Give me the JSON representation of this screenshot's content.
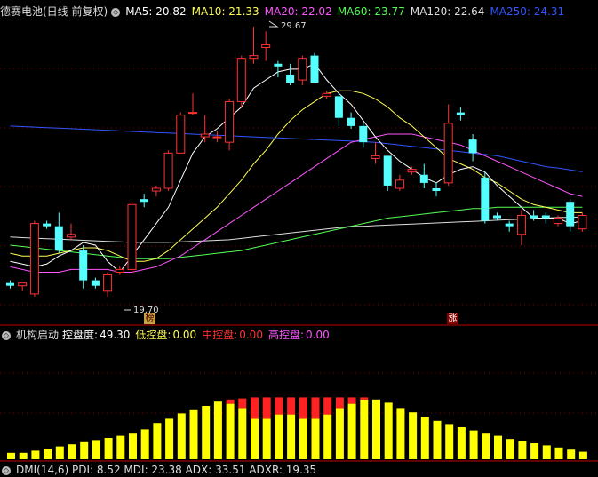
{
  "header": {
    "title": "德赛电池(日线 前复权)",
    "ma": [
      {
        "label": "MA5: 20.82",
        "color": "#ffffff"
      },
      {
        "label": "MA10: 21.33",
        "color": "#ffff55"
      },
      {
        "label": "MA20: 22.02",
        "color": "#ff55ff"
      },
      {
        "label": "MA60: 23.77",
        "color": "#55ff55"
      },
      {
        "label": "MA120: 22.64",
        "color": "#dddddd"
      },
      {
        "label": "MA250: 24.31",
        "color": "#3355ff"
      }
    ]
  },
  "annotations": {
    "high": "29.67",
    "low": "19.70",
    "badge_left": "榜",
    "badge_right": "涨"
  },
  "indicator": {
    "title": "机构启动",
    "control_label": "控盘度:",
    "control_value": "49.30",
    "low_label": "低控盘:",
    "low_value": "0.00",
    "mid_label": "中控盘:",
    "mid_value": "0.00",
    "high_label": "高控盘:",
    "high_value": "0.00"
  },
  "dmi": {
    "text": "DMI(14,6)  PDI: 8.52  MDI: 23.38  ADX: 33.51  ADXR: 19.35"
  },
  "colors": {
    "up": "#ff3333",
    "down": "#55ffff",
    "yellow": "#ffff00",
    "red": "#ff2222"
  },
  "chart_data": {
    "type": "candlestick",
    "candles": [
      [
        20.2,
        20.3,
        20.0,
        20.1
      ],
      [
        20.1,
        20.2,
        19.9,
        20.2
      ],
      [
        19.8,
        22.5,
        19.7,
        22.4
      ],
      [
        22.4,
        22.5,
        22.2,
        22.3
      ],
      [
        22.3,
        22.8,
        21.3,
        21.4
      ],
      [
        21.9,
        22.4,
        21.8,
        22.0
      ],
      [
        21.4,
        21.6,
        20.0,
        20.3
      ],
      [
        20.3,
        20.4,
        20.0,
        20.1
      ],
      [
        19.9,
        20.6,
        19.7,
        20.5
      ],
      [
        20.6,
        20.8,
        20.5,
        20.7
      ],
      [
        20.7,
        23.2,
        20.6,
        23.1
      ],
      [
        23.3,
        23.5,
        23.0,
        23.2
      ],
      [
        23.6,
        23.8,
        23.4,
        23.7
      ],
      [
        23.7,
        25.1,
        23.6,
        25.0
      ],
      [
        25.0,
        26.5,
        25.0,
        26.4
      ],
      [
        26.5,
        27.2,
        26.4,
        26.5
      ],
      [
        25.6,
        26.4,
        25.4,
        25.7
      ],
      [
        25.6,
        25.8,
        25.4,
        25.6
      ],
      [
        25.4,
        27.0,
        25.1,
        26.9
      ],
      [
        26.9,
        28.6,
        26.7,
        28.5
      ],
      [
        28.5,
        29.67,
        28.3,
        28.6
      ],
      [
        28.9,
        29.5,
        28.4,
        29.0
      ],
      [
        28.3,
        28.4,
        27.8,
        28.2
      ],
      [
        27.9,
        28.3,
        27.5,
        27.6
      ],
      [
        27.7,
        28.6,
        27.5,
        28.5
      ],
      [
        28.6,
        28.7,
        27.6,
        27.6
      ],
      [
        27.1,
        27.3,
        27.0,
        27.2
      ],
      [
        27.1,
        27.2,
        26.0,
        26.3
      ],
      [
        26.3,
        26.5,
        25.9,
        26.0
      ],
      [
        26.0,
        26.1,
        25.2,
        25.4
      ],
      [
        24.8,
        25.4,
        24.6,
        24.9
      ],
      [
        24.9,
        24.9,
        23.6,
        23.8
      ],
      [
        23.7,
        24.2,
        23.6,
        24.0
      ],
      [
        24.3,
        24.5,
        24.2,
        24.4
      ],
      [
        24.2,
        24.6,
        23.7,
        23.9
      ],
      [
        23.7,
        23.9,
        23.4,
        23.6
      ],
      [
        23.9,
        26.8,
        23.8,
        26.1
      ],
      [
        26.5,
        26.7,
        26.2,
        26.4
      ],
      [
        25.5,
        25.7,
        24.7,
        25.0
      ],
      [
        24.1,
        24.3,
        22.4,
        22.5
      ],
      [
        22.7,
        22.8,
        22.5,
        22.6
      ],
      [
        22.4,
        22.5,
        22.1,
        22.3
      ],
      [
        22.0,
        22.9,
        21.6,
        22.7
      ],
      [
        22.7,
        22.9,
        22.5,
        22.6
      ],
      [
        22.7,
        22.8,
        22.4,
        22.6
      ],
      [
        22.4,
        22.7,
        22.3,
        22.6
      ],
      [
        23.2,
        23.3,
        22.1,
        22.3
      ],
      [
        22.2,
        22.8,
        22.1,
        22.7
      ]
    ],
    "ma5": [
      21.0,
      20.9,
      20.8,
      20.9,
      21.2,
      21.4,
      21.7,
      21.6,
      21.0,
      20.6,
      21.2,
      21.8,
      22.4,
      23.0,
      24.0,
      25.0,
      25.6,
      25.9,
      26.3,
      26.7,
      27.4,
      27.7,
      28.0,
      28.1,
      28.1,
      28.3,
      27.7,
      27.2,
      26.8,
      26.2,
      25.6,
      25.1,
      24.7,
      24.4,
      24.1,
      23.9,
      24.2,
      24.4,
      24.5,
      24.3,
      23.8,
      23.4,
      23.0,
      22.6,
      22.6,
      22.6,
      22.4,
      22.5
    ],
    "ma10": [
      21.3,
      21.2,
      21.2,
      21.2,
      21.3,
      21.4,
      21.5,
      21.5,
      21.4,
      21.2,
      21.0,
      21.0,
      21.1,
      21.4,
      21.8,
      22.2,
      22.6,
      23.0,
      23.5,
      24.0,
      24.6,
      25.1,
      25.7,
      26.2,
      26.6,
      26.9,
      27.2,
      27.3,
      27.3,
      27.2,
      27.0,
      26.7,
      26.3,
      26.0,
      25.6,
      25.2,
      24.8,
      24.6,
      24.4,
      24.1,
      23.9,
      23.6,
      23.3,
      23.1,
      23.0,
      22.9,
      22.8,
      22.8
    ],
    "ma20": [
      20.8,
      20.7,
      20.6,
      20.6,
      20.6,
      20.7,
      20.7,
      20.7,
      20.7,
      20.6,
      20.6,
      20.7,
      20.8,
      21.0,
      21.2,
      21.5,
      21.8,
      22.1,
      22.4,
      22.7,
      23.0,
      23.3,
      23.6,
      23.9,
      24.2,
      24.5,
      24.8,
      25.1,
      25.4,
      25.5,
      25.6,
      25.7,
      25.7,
      25.7,
      25.6,
      25.5,
      25.4,
      25.3,
      25.1,
      24.9,
      24.7,
      24.5,
      24.3,
      24.1,
      23.9,
      23.7,
      23.5,
      23.4
    ],
    "ma60": [
      21.6,
      21.55,
      21.5,
      21.45,
      21.4,
      21.35,
      21.3,
      21.25,
      21.2,
      21.15,
      21.1,
      21.1,
      21.1,
      21.1,
      21.15,
      21.2,
      21.25,
      21.3,
      21.35,
      21.4,
      21.5,
      21.6,
      21.7,
      21.8,
      21.9,
      22.0,
      22.1,
      22.2,
      22.3,
      22.4,
      22.5,
      22.6,
      22.65,
      22.7,
      22.75,
      22.8,
      22.85,
      22.9,
      22.95,
      22.95,
      23.0,
      23.0,
      23.0,
      23.0,
      23.0,
      23.0,
      23.0,
      23.0
    ],
    "ma120": [
      21.9,
      21.88,
      21.86,
      21.84,
      21.82,
      21.8,
      21.78,
      21.76,
      21.74,
      21.72,
      21.7,
      21.7,
      21.7,
      21.7,
      21.72,
      21.74,
      21.76,
      21.78,
      21.8,
      21.85,
      21.9,
      21.95,
      22.0,
      22.05,
      22.1,
      22.15,
      22.2,
      22.25,
      22.3,
      22.3,
      22.32,
      22.34,
      22.36,
      22.38,
      22.4,
      22.42,
      22.44,
      22.46,
      22.48,
      22.5,
      22.52,
      22.54,
      22.56,
      22.58,
      22.6,
      22.62,
      22.63,
      22.64
    ],
    "ma250": [
      26.0,
      25.98,
      25.96,
      25.94,
      25.92,
      25.9,
      25.88,
      25.86,
      25.84,
      25.82,
      25.8,
      25.78,
      25.76,
      25.74,
      25.72,
      25.7,
      25.68,
      25.66,
      25.64,
      25.62,
      25.6,
      25.58,
      25.56,
      25.54,
      25.52,
      25.5,
      25.48,
      25.46,
      25.44,
      25.42,
      25.4,
      25.35,
      25.3,
      25.25,
      25.2,
      25.15,
      25.1,
      25.05,
      25.0,
      24.95,
      24.9,
      24.8,
      24.7,
      24.6,
      24.5,
      24.45,
      24.38,
      24.31
    ],
    "control_bars": [
      {
        "y": 6,
        "r": 0
      },
      {
        "y": 6,
        "r": 0
      },
      {
        "y": 8,
        "r": 0
      },
      {
        "y": 10,
        "r": 0
      },
      {
        "y": 12,
        "r": 0
      },
      {
        "y": 14,
        "r": 0
      },
      {
        "y": 16,
        "r": 0
      },
      {
        "y": 18,
        "r": 0
      },
      {
        "y": 20,
        "r": 0
      },
      {
        "y": 22,
        "r": 0
      },
      {
        "y": 24,
        "r": 0
      },
      {
        "y": 28,
        "r": 0
      },
      {
        "y": 34,
        "r": 0
      },
      {
        "y": 38,
        "r": 0
      },
      {
        "y": 43,
        "r": 0
      },
      {
        "y": 46,
        "r": 0
      },
      {
        "y": 50,
        "r": 0
      },
      {
        "y": 54,
        "r": 0
      },
      {
        "y": 56,
        "r": 4
      },
      {
        "y": 57,
        "r": 9
      },
      {
        "y": 58,
        "r": 20
      },
      {
        "y": 58,
        "r": 20
      },
      {
        "y": 58,
        "r": 16
      },
      {
        "y": 58,
        "r": 16
      },
      {
        "y": 58,
        "r": 20
      },
      {
        "y": 58,
        "r": 20
      },
      {
        "y": 58,
        "r": 16
      },
      {
        "y": 58,
        "r": 10
      },
      {
        "y": 58,
        "r": 6
      },
      {
        "y": 58,
        "r": 2
      },
      {
        "y": 56,
        "r": 0
      },
      {
        "y": 53,
        "r": 0
      },
      {
        "y": 48,
        "r": 0
      },
      {
        "y": 44,
        "r": 0
      },
      {
        "y": 40,
        "r": 0
      },
      {
        "y": 36,
        "r": 0
      },
      {
        "y": 33,
        "r": 0
      },
      {
        "y": 30,
        "r": 0
      },
      {
        "y": 27,
        "r": 0
      },
      {
        "y": 24,
        "r": 0
      },
      {
        "y": 22,
        "r": 0
      },
      {
        "y": 19,
        "r": 0
      },
      {
        "y": 17,
        "r": 0
      },
      {
        "y": 15,
        "r": 0
      },
      {
        "y": 13,
        "r": 0
      },
      {
        "y": 11,
        "r": 0
      },
      {
        "y": 9,
        "r": 0
      },
      {
        "y": 7,
        "r": 0
      }
    ]
  }
}
